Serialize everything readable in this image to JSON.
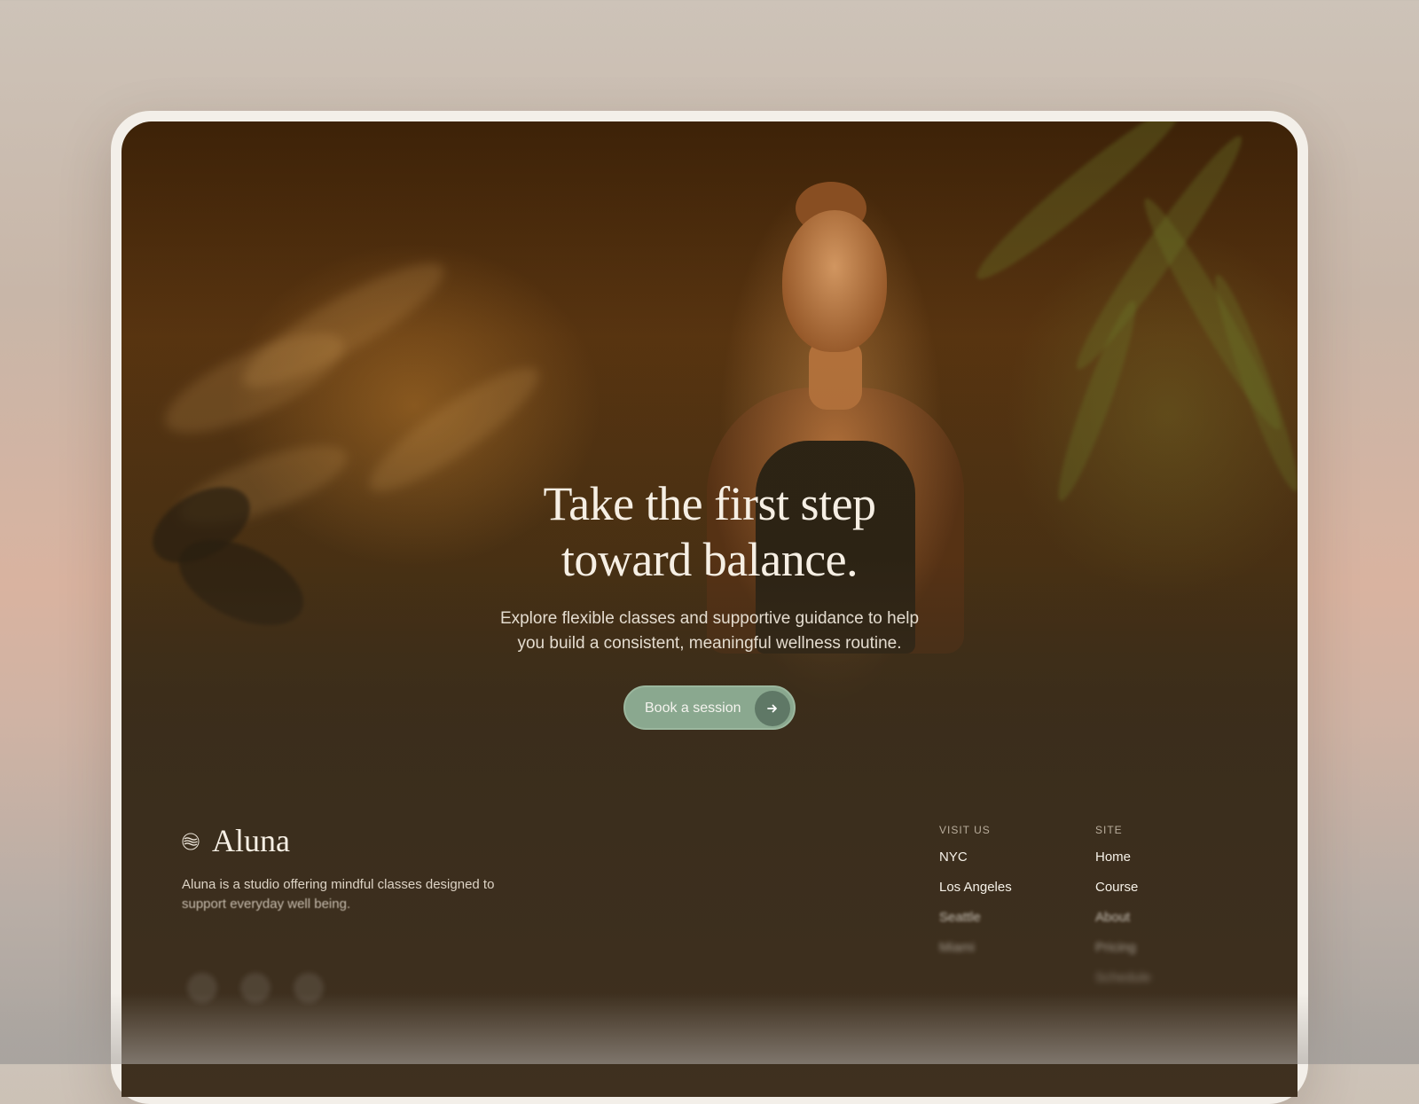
{
  "hero": {
    "title_line1": "Take the first step",
    "title_line2": "toward balance.",
    "subtitle_line1": "Explore flexible classes and supportive guidance to help",
    "subtitle_line2": "you build a consistent, meaningful wellness routine.",
    "cta_label": "Book a session",
    "cta_icon": "arrow-right-icon"
  },
  "footer": {
    "brand_name": "Aluna",
    "brand_icon": "wave-circle-logo-icon",
    "description_line1": "Aluna is a studio offering mindful classes designed to",
    "description_line2": "support everyday well being.",
    "visit_us": {
      "heading": "VISIT US",
      "links": [
        "NYC",
        "Los Angeles",
        "Seattle",
        "Miami"
      ]
    },
    "site": {
      "heading": "SITE",
      "links": [
        "Home",
        "Course",
        "About",
        "Pricing",
        "Schedule"
      ]
    },
    "social_icons": [
      "instagram-icon",
      "x-icon",
      "facebook-icon"
    ]
  },
  "colors": {
    "cta_bg": "#8aa88f",
    "cta_arrow_bg": "#5f7866",
    "heading_text": "#f6efe4",
    "footer_bg": "#3b2e1d"
  }
}
